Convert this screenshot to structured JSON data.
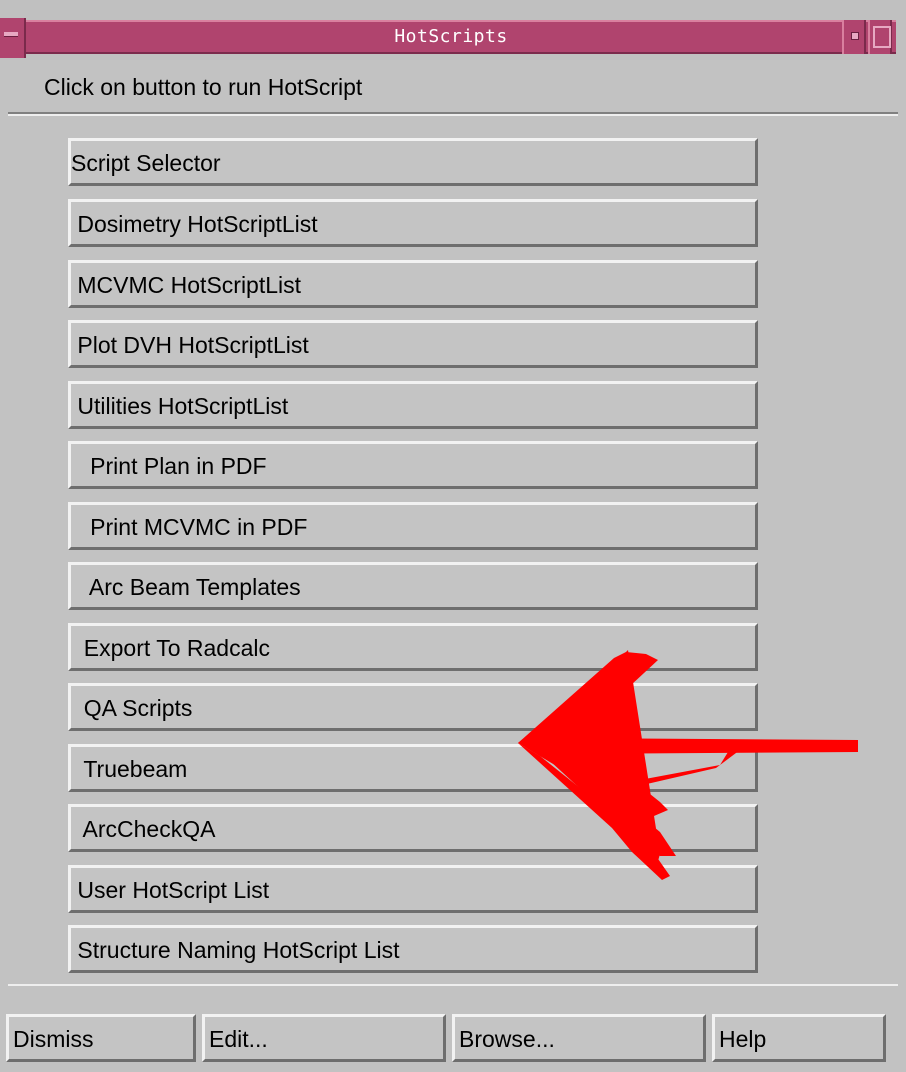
{
  "window": {
    "title": "HotScripts",
    "header_text": "Click on button to run HotScript"
  },
  "script_buttons": [
    {
      "label": "Script Selector"
    },
    {
      "label": " Dosimetry HotScriptList"
    },
    {
      "label": " MCVMC HotScriptList"
    },
    {
      "label": " Plot DVH HotScriptList"
    },
    {
      "label": " Utilities HotScriptList"
    },
    {
      "label": "   Print Plan in PDF"
    },
    {
      "label": "   Print MCVMC in PDF"
    },
    {
      "label": "   Arc Beam Templates"
    },
    {
      "label": "  Export To Radcalc"
    },
    {
      "label": "  QA Scripts"
    },
    {
      "label": "  Truebeam"
    },
    {
      "label": "  ArcCheckQA"
    },
    {
      "label": " User HotScript List"
    },
    {
      "label": " Structure Naming HotScript List"
    }
  ],
  "bottom_buttons": {
    "dismiss": "Dismiss",
    "edit": "Edit...",
    "browse": "Browse...",
    "help": "Help"
  },
  "colors": {
    "titlebar": "#b0446e",
    "window_bg": "#c2c2c2",
    "annotation_arrow": "#ff0000"
  },
  "icons": {
    "window_menu": "window-menu-icon",
    "minimize": "minimize-icon",
    "maximize": "maximize-icon",
    "annotation": "red-arrow-annotation"
  }
}
